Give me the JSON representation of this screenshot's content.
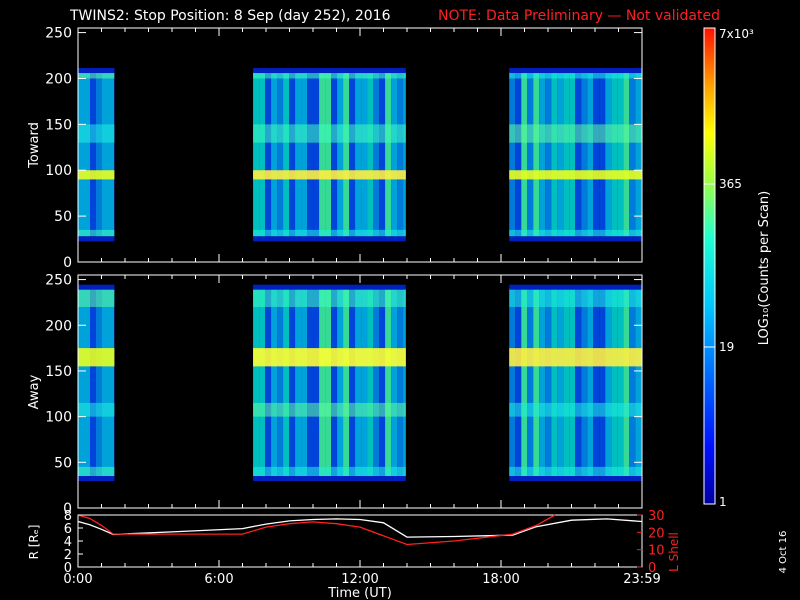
{
  "header": {
    "title": "TWINS2: Stop Position:  8 Sep (day 252), 2016",
    "note": "NOTE: Data Preliminary — Not validated"
  },
  "colorbar": {
    "label": "LOG₁₀(Counts per Scan)",
    "ticks": [
      "7x10³",
      "365",
      "19",
      "1"
    ]
  },
  "footer": {
    "side_date": "4 Oct 16"
  },
  "chart_data": [
    {
      "type": "heatmap",
      "panel": "toward",
      "ylabel": "Toward",
      "ylim": [
        0,
        255
      ],
      "yticks": [
        "0",
        "50",
        "100",
        "150",
        "200",
        "250"
      ],
      "xlim_hours": [
        0,
        24
      ],
      "data_intervals_hours": [
        [
          0.0,
          1.55
        ],
        [
          7.45,
          13.95
        ],
        [
          18.35,
          24.0
        ]
      ],
      "bands": [
        {
          "y_range": [
            200,
            207
          ],
          "level": "high"
        },
        {
          "y_range": [
            130,
            150
          ],
          "level": "high"
        },
        {
          "y_range": [
            90,
            100
          ],
          "level": "peak"
        },
        {
          "y_range": [
            28,
            35
          ],
          "level": "high"
        }
      ]
    },
    {
      "type": "heatmap",
      "panel": "away",
      "ylabel": "Away",
      "ylim": [
        0,
        255
      ],
      "yticks": [
        "0",
        "50",
        "100",
        "150",
        "200",
        "250"
      ],
      "xlim_hours": [
        0,
        24
      ],
      "data_intervals_hours": [
        [
          0.0,
          1.55
        ],
        [
          7.45,
          13.95
        ],
        [
          18.35,
          24.0
        ]
      ],
      "bands": [
        {
          "y_range": [
            220,
            240
          ],
          "level": "high"
        },
        {
          "y_range": [
            155,
            175
          ],
          "level": "peak"
        },
        {
          "y_range": [
            100,
            115
          ],
          "level": "high"
        },
        {
          "y_range": [
            35,
            45
          ],
          "level": "high"
        }
      ]
    },
    {
      "type": "line",
      "panel": "orbit",
      "ylabel": "R [Rₑ]",
      "y2label": "L Shell",
      "ylim": [
        0,
        8
      ],
      "yticks": [
        "0",
        "2",
        "4",
        "6",
        "8"
      ],
      "y2lim": [
        0,
        30
      ],
      "y2ticks": [
        "0",
        "10",
        "20",
        "30"
      ],
      "xlabel": "Time (UT)",
      "xticks": [
        "0:00",
        "6:00",
        "12:00",
        "18:00",
        "23:59"
      ],
      "series": [
        {
          "color": "#ffffff",
          "x": [
            0,
            0.5,
            1.0,
            1.5,
            2.0,
            4.0,
            7.0,
            8.0,
            9.0,
            10.0,
            11.0,
            12.0,
            13.0,
            14.0,
            16.0,
            18.5,
            19.5,
            21.0,
            22.5,
            24.0
          ],
          "y": [
            7.0,
            6.5,
            5.8,
            5.0,
            5.1,
            5.4,
            5.9,
            6.6,
            7.1,
            7.3,
            7.4,
            7.3,
            6.8,
            4.6,
            4.7,
            4.9,
            6.2,
            7.2,
            7.4,
            7.0
          ]
        },
        {
          "color": "#ff2020",
          "x": [
            0.0,
            0.5,
            1.0,
            1.5,
            2.0,
            4.0,
            7.0,
            8.0,
            9.0,
            10.0,
            11.0,
            12.0,
            13.0,
            14.0,
            16.0,
            18.5,
            19.5,
            20.3
          ],
          "y": [
            30,
            28,
            24,
            19,
            19,
            19,
            19,
            23,
            25,
            26,
            25,
            23,
            18,
            13,
            15,
            19,
            24,
            30
          ]
        }
      ]
    }
  ]
}
